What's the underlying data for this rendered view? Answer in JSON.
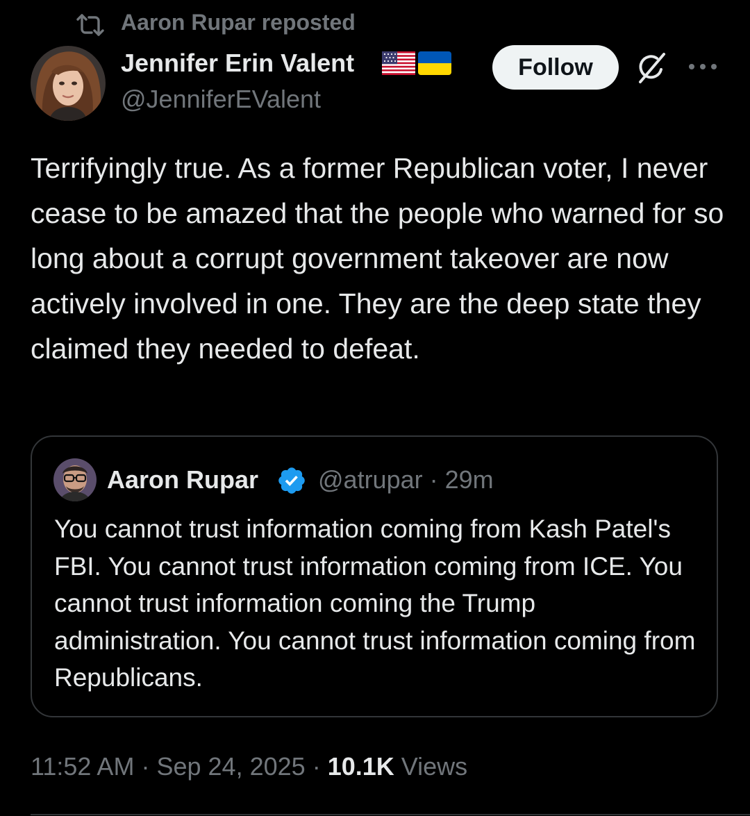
{
  "repost": {
    "icon": "repost-icon",
    "text": "Aaron Rupar reposted"
  },
  "author": {
    "avatar_icon": "avatar",
    "display_name": "Jennifer Erin Valent",
    "flags": [
      "us-flag-icon",
      "ukraine-flag-icon"
    ],
    "handle": "@JenniferEValent"
  },
  "actions": {
    "follow_label": "Follow",
    "grok_icon": "grok-icon",
    "more_icon": "more-icon"
  },
  "tweet": {
    "text": "Terrifyingly true. As a former Republican voter, I never cease to be amazed that the people who warned for so long about a corrupt government takeover are now actively involved in one. They are the deep state they claimed they needed to defeat."
  },
  "quote": {
    "display_name": "Aaron Rupar",
    "verified_icon": "verified-badge-icon",
    "handle": "@atrupar",
    "separator": "·",
    "time_ago": "29m",
    "text": "You cannot trust information coming from Kash Patel's FBI. You cannot trust information coming from ICE. You cannot trust information coming the Trump administration. You cannot trust information coming from Republicans."
  },
  "footer": {
    "time": "11:52 AM",
    "separator": "·",
    "date": "Sep 24, 2025",
    "views_count": "10.1K",
    "views_label": "Views"
  },
  "colors": {
    "background": "#000000",
    "text_primary": "#e7e9ea",
    "text_secondary": "#71767b",
    "border": "#333639",
    "follow_bg": "#eff3f4",
    "verified_blue": "#1d9bf0"
  }
}
